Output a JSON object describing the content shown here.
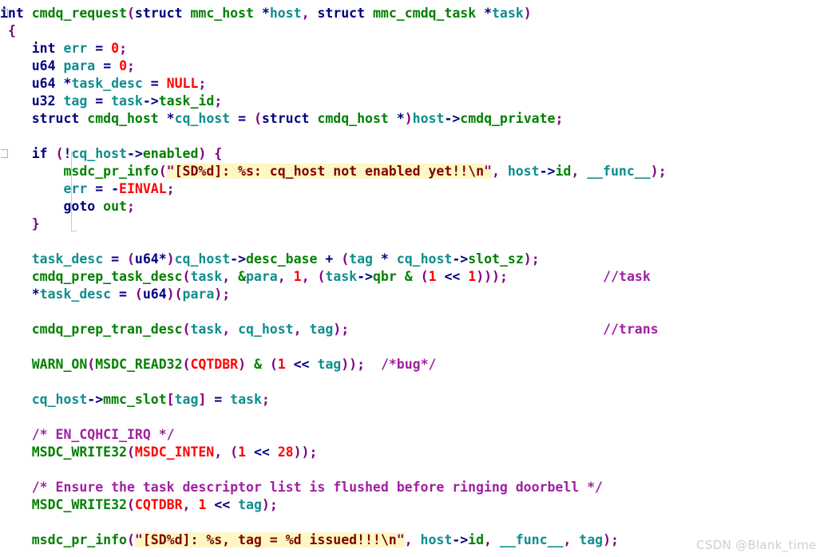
{
  "editor": {
    "language": "C",
    "background": "#ffffff",
    "colors": {
      "keyword": "#000080",
      "type": "#008000",
      "identifier": "#0e8d8d",
      "number": "#ff0000",
      "macro": "#ff0000",
      "punctuation": "#800080",
      "comment": "#a020a0",
      "string_text": "#800000",
      "string_highlight": "#fdf7c3",
      "fold_marker": "#b0b0b0"
    }
  },
  "gutter": {
    "fold_markers": [
      {
        "line": 1,
        "state": "collapsible"
      },
      {
        "line": 8,
        "state": "collapsible"
      }
    ],
    "fold_guide": {
      "from_line": 8,
      "to_line": 13
    }
  },
  "code": {
    "lines": [
      {
        "n": 1,
        "text": "int cmdq_request(struct mmc_host *host, struct mmc_cmdq_task *task)"
      },
      {
        "n": 2,
        "text": "{"
      },
      {
        "n": 3,
        "text": "    int err = 0;"
      },
      {
        "n": 4,
        "text": "    u64 para = 0;"
      },
      {
        "n": 5,
        "text": "    u64 *task_desc = NULL;"
      },
      {
        "n": 6,
        "text": "    u32 tag = task->task_id;"
      },
      {
        "n": 7,
        "text": "    struct cmdq_host *cq_host = (struct cmdq_host *)host->cmdq_private;"
      },
      {
        "n": 8,
        "text": ""
      },
      {
        "n": 9,
        "text": "    if (!cq_host->enabled) {"
      },
      {
        "n": 10,
        "text": "        msdc_pr_info(\"[SD%d]: %s: cq_host not enabled yet!!\\n\", host->id, __func__);"
      },
      {
        "n": 11,
        "text": "        err = -EINVAL;"
      },
      {
        "n": 12,
        "text": "        goto out;"
      },
      {
        "n": 13,
        "text": "    }"
      },
      {
        "n": 14,
        "text": ""
      },
      {
        "n": 15,
        "text": "    task_desc = (u64*)cq_host->desc_base + (tag * cq_host->slot_sz);"
      },
      {
        "n": 16,
        "text": "    cmdq_prep_task_desc(task, &para, 1, (task->qbr & (1 << 1)));            //task"
      },
      {
        "n": 17,
        "text": "    *task_desc = (u64)(para);"
      },
      {
        "n": 18,
        "text": ""
      },
      {
        "n": 19,
        "text": "    cmdq_prep_tran_desc(task, cq_host, tag);                                //trans"
      },
      {
        "n": 20,
        "text": ""
      },
      {
        "n": 21,
        "text": "    WARN_ON(MSDC_READ32(CQTDBR) & (1 << tag));  /*bug*/"
      },
      {
        "n": 22,
        "text": ""
      },
      {
        "n": 23,
        "text": "    cq_host->mmc_slot[tag] = task;"
      },
      {
        "n": 24,
        "text": ""
      },
      {
        "n": 25,
        "text": "    /* EN_CQHCI_IRQ */"
      },
      {
        "n": 26,
        "text": "    MSDC_WRITE32(MSDC_INTEN, (1 << 28));"
      },
      {
        "n": 27,
        "text": ""
      },
      {
        "n": 28,
        "text": "    /* Ensure the task descriptor list is flushed before ringing doorbell */"
      },
      {
        "n": 29,
        "text": "    MSDC_WRITE32(CQTDBR, 1 << tag);"
      },
      {
        "n": 30,
        "text": ""
      },
      {
        "n": 31,
        "text": "    msdc_pr_info(\"[SD%d]: %s, tag = %d issued!!!\\n\", host->id, __func__, tag);"
      }
    ],
    "strings": [
      "[SD%d]: %s: cq_host not enabled yet!!\\n",
      "[SD%d]: %s, tag = %d issued!!!\\n"
    ],
    "comments": [
      "//task",
      "//trans",
      "/*bug*/",
      "/* EN_CQHCI_IRQ */",
      "/* Ensure the task descriptor list is flushed before ringing doorbell */"
    ],
    "macros": [
      "NULL",
      "EINVAL",
      "CQTDBR",
      "MSDC_INTEN",
      "WARN_ON",
      "MSDC_READ32",
      "MSDC_WRITE32"
    ],
    "numbers": [
      "0",
      "0",
      "1",
      "1",
      "1",
      "1",
      "1",
      "28",
      "1"
    ]
  },
  "watermark": {
    "text": "CSDN @Blank_time",
    "color": "#cfcfcf"
  }
}
